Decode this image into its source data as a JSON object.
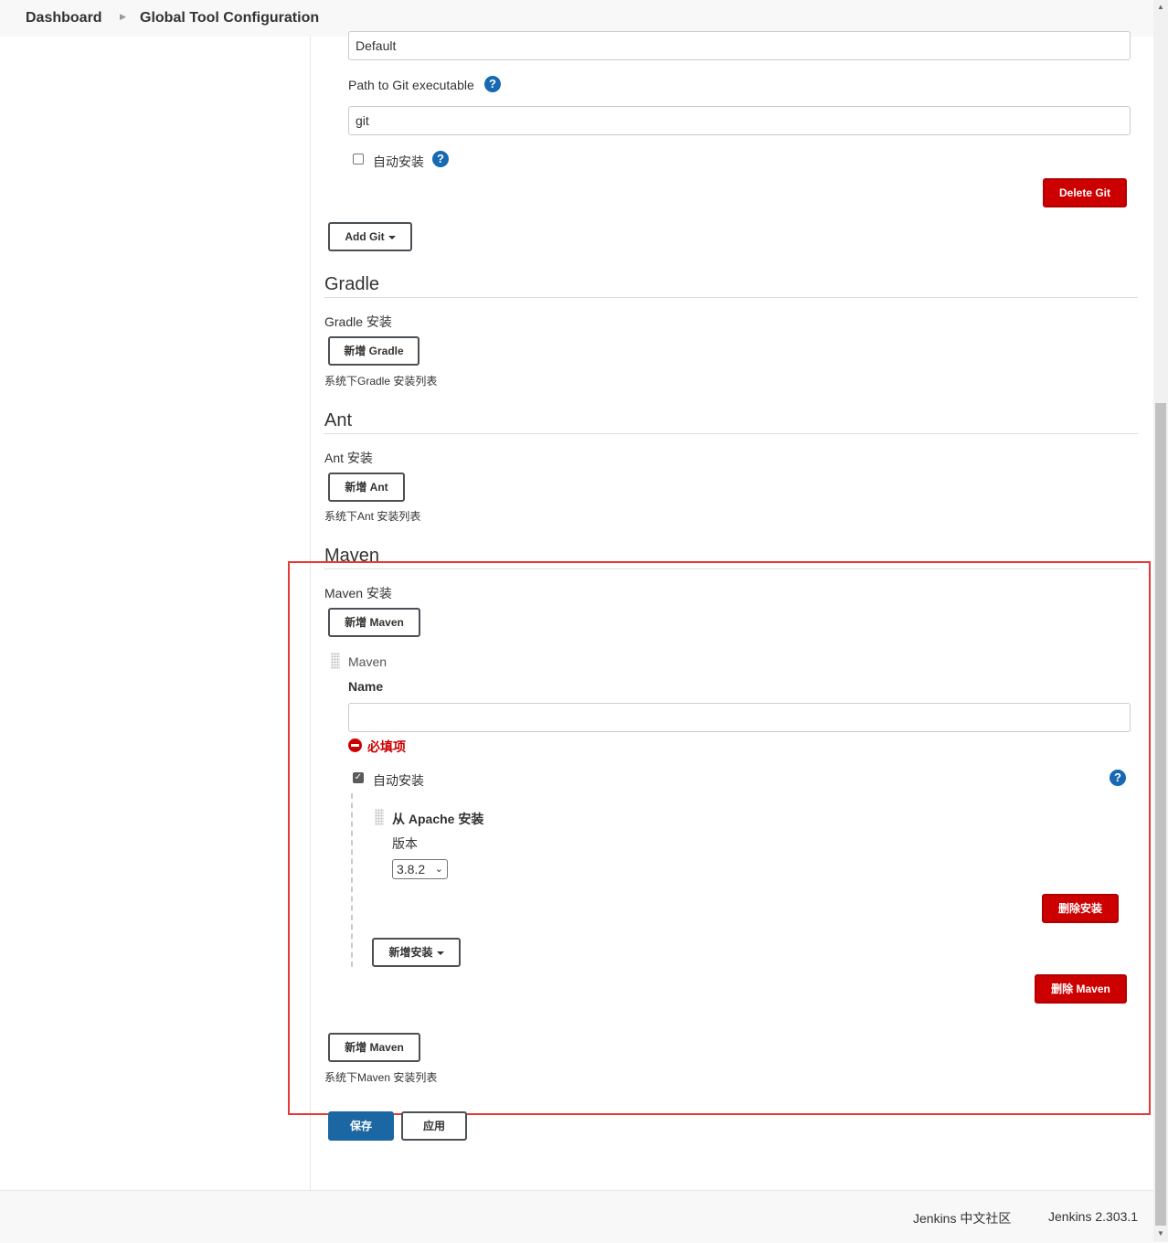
{
  "breadcrumb": {
    "items": [
      "Dashboard",
      "Global Tool Configuration"
    ]
  },
  "git": {
    "name_value": "Default",
    "path_label": "Path to Git executable",
    "path_value": "git",
    "auto_install_label": "自动安装",
    "auto_install_checked": false,
    "delete_label": "Delete Git",
    "add_label": "Add Git"
  },
  "gradle": {
    "title": "Gradle",
    "install_label": "Gradle 安装",
    "add_label": "新增 Gradle",
    "list_note": "系统下Gradle 安装列表"
  },
  "ant": {
    "title": "Ant",
    "install_label": "Ant 安装",
    "add_label": "新增 Ant",
    "list_note": "系统下Ant 安装列表"
  },
  "maven": {
    "title": "Maven",
    "install_label": "Maven 安装",
    "add_label_top": "新增 Maven",
    "item_header": "Maven",
    "name_label": "Name",
    "name_value": "",
    "required_error": "必填项",
    "auto_install_label": "自动安装",
    "auto_install_checked": true,
    "installer_title": "从 Apache 安装",
    "version_label": "版本",
    "version_selected": "3.8.2",
    "delete_installer_label": "删除安装",
    "add_installer_label": "新增安装",
    "delete_label": "删除 Maven",
    "add_label_bottom": "新增 Maven",
    "list_note": "系统下Maven 安装列表"
  },
  "actions": {
    "save_label": "保存",
    "apply_label": "应用"
  },
  "footer": {
    "community_label": "Jenkins 中文社区",
    "version_label": "Jenkins 2.303.1"
  },
  "colors": {
    "danger": "#cc0000",
    "primary": "#1a67a3",
    "help": "#1769b3",
    "highlight": "#e53935"
  }
}
